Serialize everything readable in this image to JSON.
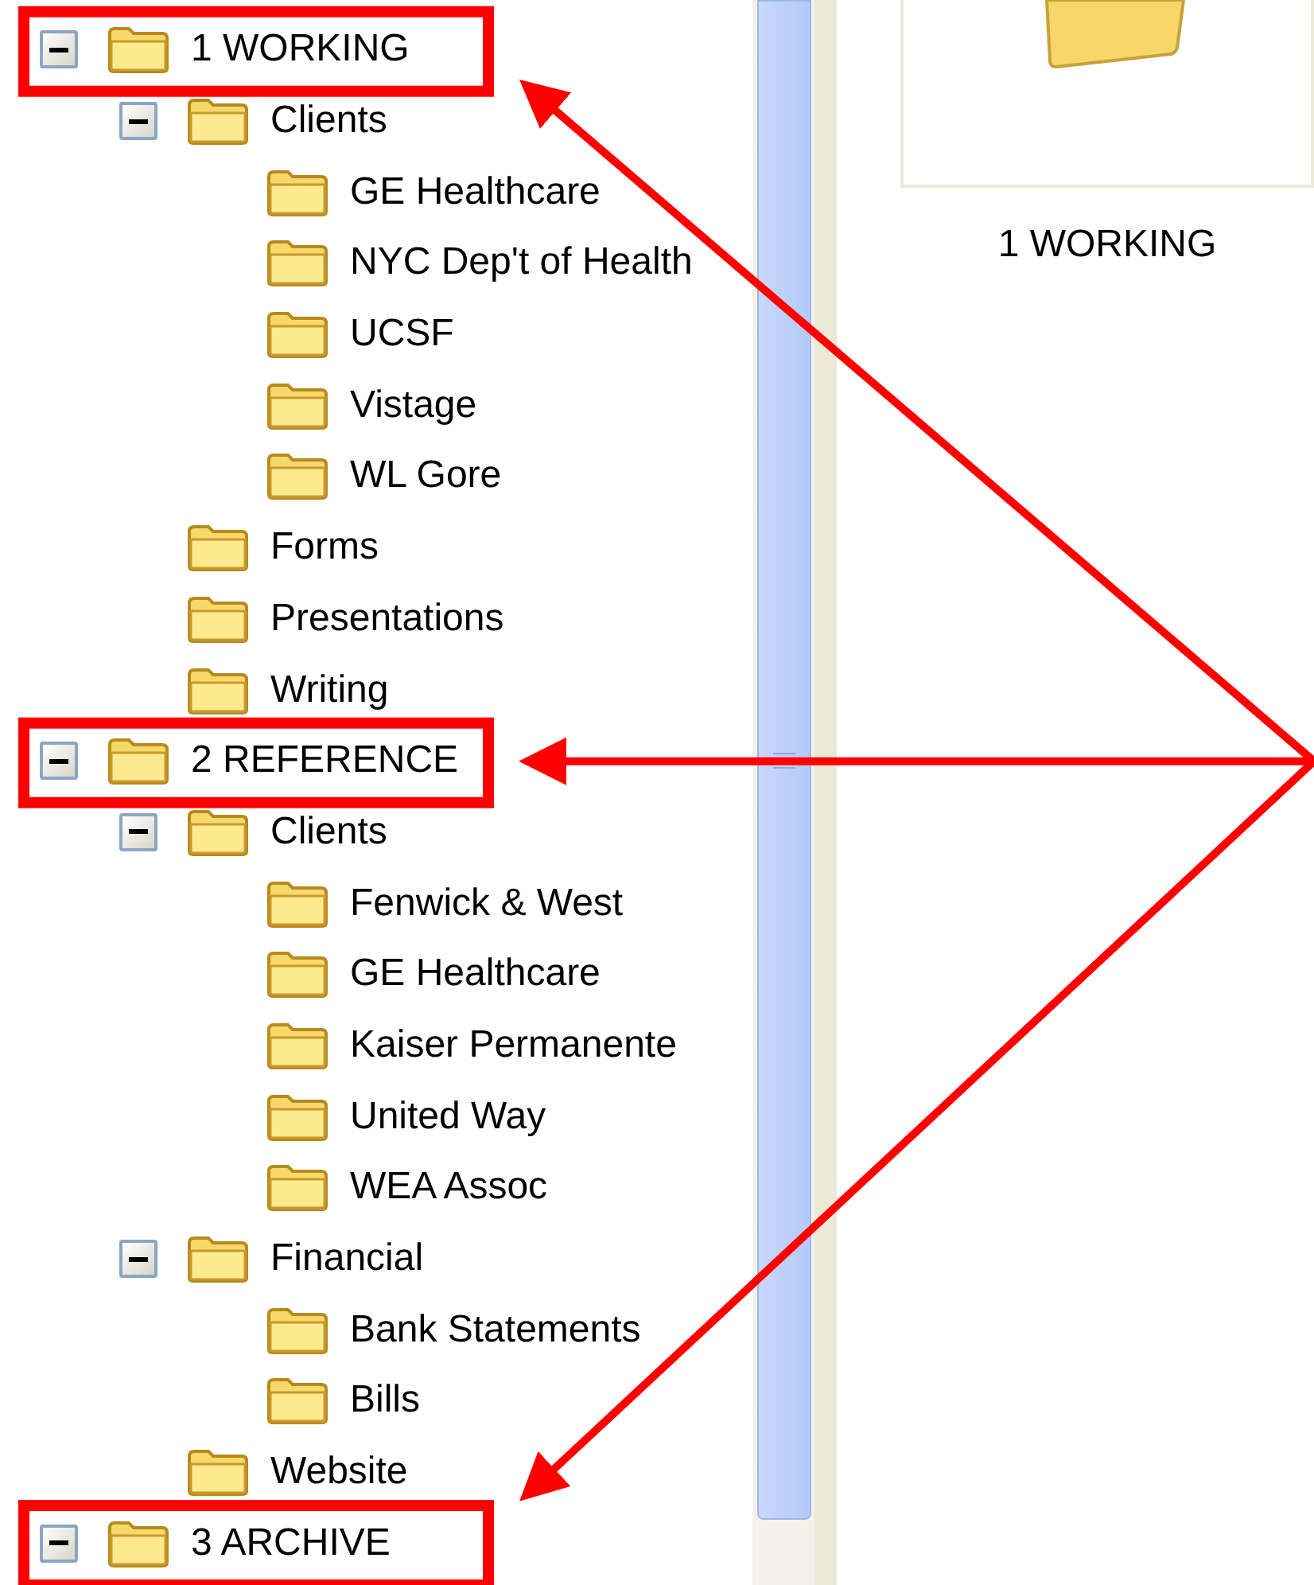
{
  "folder_tree": [
    {
      "label": "1 WORKING",
      "expanded": true,
      "highlighted": true,
      "children": [
        {
          "label": "Clients",
          "expanded": true,
          "children": [
            {
              "label": "GE Healthcare"
            },
            {
              "label": "NYC Dep't of Health"
            },
            {
              "label": "UCSF"
            },
            {
              "label": "Vistage"
            },
            {
              "label": "WL Gore"
            }
          ]
        },
        {
          "label": "Forms"
        },
        {
          "label": "Presentations"
        },
        {
          "label": "Writing"
        }
      ]
    },
    {
      "label": "2 REFERENCE",
      "expanded": true,
      "highlighted": true,
      "children": [
        {
          "label": "Clients",
          "expanded": true,
          "children": [
            {
              "label": "Fenwick & West"
            },
            {
              "label": "GE Healthcare"
            },
            {
              "label": "Kaiser Permanente"
            },
            {
              "label": "United Way"
            },
            {
              "label": "WEA Assoc"
            }
          ]
        },
        {
          "label": "Financial",
          "expanded": true,
          "children": [
            {
              "label": "Bank Statements"
            },
            {
              "label": "Bills"
            }
          ]
        },
        {
          "label": "Website"
        }
      ]
    },
    {
      "label": "3 ARCHIVE",
      "expanded": true,
      "highlighted": true
    }
  ],
  "content_view": {
    "items": [
      {
        "label": "1 WORKING"
      }
    ]
  }
}
